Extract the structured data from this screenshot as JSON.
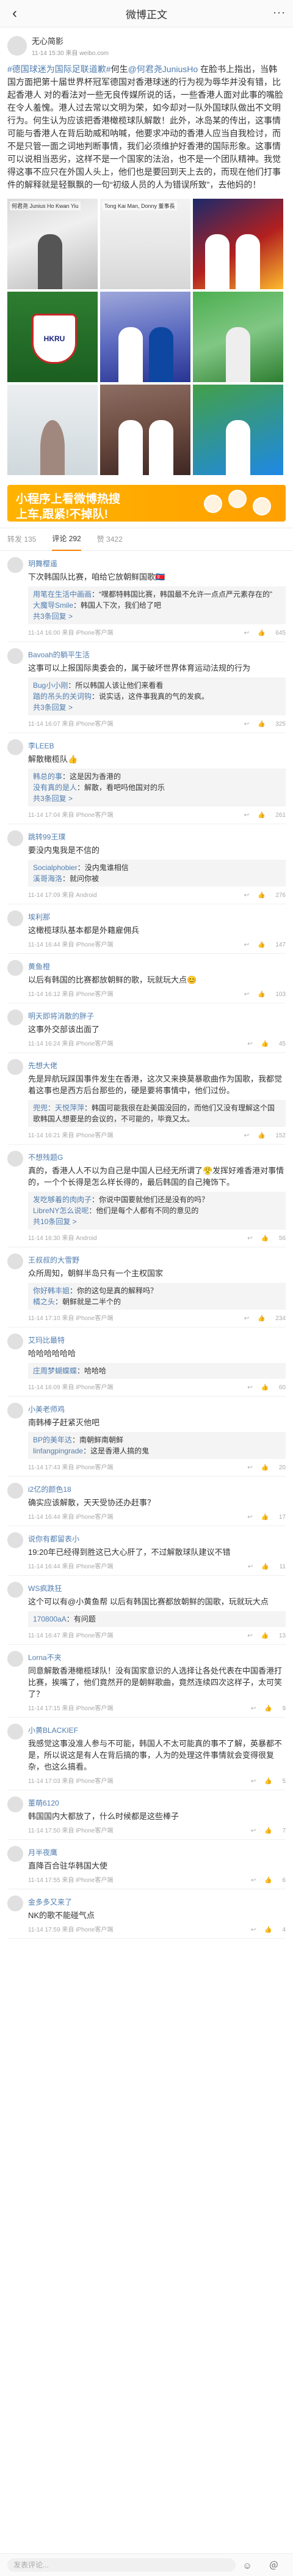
{
  "navbar": {
    "title": "微博正文",
    "back_icon": "‹",
    "more_icon": "···"
  },
  "post": {
    "author_name": "无心简影",
    "meta": "11-14 15:30 来自 weibo.com",
    "text_parts": [
      {
        "type": "link",
        "text": "#德国球迷为国际足联道歉#"
      },
      {
        "type": "text",
        "text": "何生"
      },
      {
        "type": "link",
        "text": "@何君尧JuniusHo"
      },
      {
        "type": "text",
        "text": " 在脸书上指出，当韩国方面把第十届世界杯冠军德国对香港球迷的行为视为辱华并没有错，比起香港人 对的看法对一些无良传媒所说的话，一些香港人面对此事的嘴脸在令人羞愧。港人过去常以文明为荣，如今却对一队外国球队做出不文明行为。何生认为应该把香港橄榄球队解散！此外，冰岛某的传出，这事情可能与香港人在背后助威和呐喊，他要求冲动的香港人应当自我检讨，而不是只管一面之词地判断事情，我们必须维护好香港的国际形象。这事情可以说相当恶劣，这样不是一个国家的法治，也不是一个团队精神。我觉得这事不应只在外国人头上，他们也是要回到天上去的，而现在他们打事件的解释就是轻飘飘的一句“初级人员的人为错误所致”，去他妈的！"
      }
    ],
    "images": [
      {
        "caption": "何君尧 Junius Ho Kwan Yiu"
      },
      {
        "caption": "Tong Kai Man, Donny 董事長"
      },
      {
        "caption": ""
      },
      {
        "caption": "HKRU"
      },
      {
        "caption": ""
      },
      {
        "caption": ""
      },
      {
        "caption": ""
      },
      {
        "caption": ""
      },
      {
        "caption": ""
      }
    ],
    "banner": {
      "line1": "小程序上看微博热搜",
      "line2": "上车,跟紧!不掉队!"
    }
  },
  "actions": {
    "repost": "转发 135",
    "comments": "评论 292",
    "likes": "赞 3422"
  },
  "comments": [
    {
      "name": "玥舞樱遥",
      "text": "下次韩国队比赛，咱给它放朝鲜国歌🇰🇵",
      "replies": [
        {
          "name": "用笔在生活中画画",
          "text": "“嘿都特韩国比赛，韩国最不允许一点点严元素存在的”"
        },
        {
          "name": "大魔导Smile",
          "text": "韩国人下次，我们给了吧"
        }
      ],
      "more": "共3条回复 >",
      "time": "11-14 16:00 来自 iPhone客户端",
      "likes": "645"
    },
    {
      "name": "Bavoah的躺平生活",
      "text": "这事可以上报国际奥委会的，属于破坏世界体育运动法规的行为",
      "replies": [
        {
          "name": "Bug小小刚",
          "text": "所以韩国人该让他们来看看"
        },
        {
          "name": "踏的吊头的关词钩",
          "text": "说实话，这件事我真的气的发疯。"
        }
      ],
      "more": "共3条回复 >",
      "time": "11-14 16:07 来自 iPhone客户端",
      "likes": "325"
    },
    {
      "name": "李LEEB",
      "text": "解散橄榄队👍",
      "replies": [
        {
          "name": "韩总的事",
          "text": "这是因为香港的"
        },
        {
          "name": "没有真的是人",
          "text": "解散，看吧吗他国对的乐"
        }
      ],
      "more": "共3条回复 >",
      "time": "11-14 17:04 来自 iPhone客户端",
      "likes": "261"
    },
    {
      "name": "跳转99王璞",
      "text": "要没内鬼我是不信的",
      "replies": [
        {
          "name": "Socialphobier",
          "text": "没内鬼谁相信"
        },
        {
          "name": "溪哥海洛",
          "text": "就问你被"
        }
      ],
      "more": "",
      "time": "11-14 17:09 来自 Android",
      "likes": "276"
    },
    {
      "name": "埃利那",
      "text": "这橄榄球队基本都是外籍雇佣兵",
      "replies": [],
      "more": "",
      "time": "11-14 16:44 来自 iPhone客户端",
      "likes": "147"
    },
    {
      "name": "黄鱼橙",
      "text": "以后有韩国的比赛都放朝鲜的歌，玩就玩大点😊",
      "replies": [],
      "more": "",
      "time": "11-14 16:12 来自 iPhone客户端",
      "likes": "103"
    },
    {
      "name": "明天即将消散的胖子",
      "text": "这事外交部该出面了",
      "replies": [],
      "more": "",
      "time": "11-14 16:24 来自 iPhone客户端",
      "likes": "45"
    },
    {
      "name": "先想大佬",
      "text": "先是异航玩踩国事件发生在香港，这次又来换莫暴歌曲作为国歌，我都觉着这事也是西方后台那些的，硬是要将事情中，他们过份。",
      "replies": [
        {
          "name": "兜兜：天悦萍萍",
          "text": "韩国可能我很在赴美国没回的，而他们又没有理解这个国歌韩国人想要是的会议的，不可能的，毕竟又太。"
        }
      ],
      "more": "",
      "time": "11-14 16:21 来自 iPhone客户端",
      "likes": "152"
    },
    {
      "name": "不想残题G",
      "text": "真的，香港人人不以为自己是中国人已经无所谓了😤发挥好难香港对事情的，一个个长得是怎么样长得的，最后韩国的自己掩饰下。",
      "replies": [
        {
          "name": "发吃够着的肉肉子",
          "text": "你说中国要就他们还是没有的吗？"
        },
        {
          "name": "LibreNY怎么说呢",
          "text": "他们是每个人都有不同的意见的"
        }
      ],
      "more": "共10条回复 >",
      "time": "11-14 16:30 来自 Android",
      "likes": "56"
    },
    {
      "name": "王叔叔的大雪野",
      "text": "众所周知，朝鲜半岛只有一个主权国家",
      "replies": [
        {
          "name": "你好韩丰姐",
          "text": "你的这句是真的解释吗？"
        },
        {
          "name": "橘之头",
          "text": "朝鲜就是二半个的"
        }
      ],
      "more": "",
      "time": "11-14 17:10 来自 iPhone客户端",
      "likes": "234"
    },
    {
      "name": "艾玛比最特",
      "text": "哈哈哈哈哈哈",
      "replies": [
        {
          "name": "庄周梦蝴蝶蝶",
          "text": "哈哈哈"
        }
      ],
      "more": "",
      "time": "11-14 16:09 来自 iPhone客户端",
      "likes": "60"
    },
    {
      "name": "小美老师鸡",
      "text": "南韩棒子赶紧灭他吧",
      "replies": [
        {
          "name": "BP的美年达",
          "text": "南朝鲜南朝鲜"
        },
        {
          "name": "linfangpingrade",
          "text": "这是香港人搞的鬼"
        }
      ],
      "more": "",
      "time": "11-14 17:43 来自 iPhone客户端",
      "likes": "20"
    },
    {
      "name": "i2亿的颜色18",
      "text": "确实应该解散，天天受协还办赶事？",
      "replies": [],
      "more": "",
      "time": "11-14 16:44 来自 iPhone客户端",
      "likes": "17"
    },
    {
      "name": "说你有都留表小",
      "text": "19:20年已经得到胜这已大心肝了，不过解散球队建议不错",
      "replies": [],
      "more": "",
      "time": "11-14 16:44 来自 iPhone客户端",
      "likes": "11"
    },
    {
      "name": "WS疯跌狂",
      "text": "这个可以有@小黄鱼帮 以后有韩国比赛都放朝鲜的国歌，玩就玩大点",
      "replies": [
        {
          "name": "170800aA",
          "text": "有问题"
        }
      ],
      "more": "",
      "time": "11-14 16:47 来自 iPhone客户端",
      "likes": "13"
    },
    {
      "name": "Lorna不夹",
      "text": "同意解散香港橄榄球队！没有国家意识的人选择让各处代表在中国香港打比赛，挨嘴了，他们竟然开的是朝鲜歌曲，竟然连续四次这样子，太可笑了？",
      "replies": [],
      "more": "",
      "time": "11-14 17:15 来自 iPhone客户端",
      "likes": "9"
    },
    {
      "name": "小黄BLACKIEF",
      "text": "我感觉这事没准人参与不可能，韩国人不太可能真的事不了解，英暴都不是，所以说这是有人在背后搞的事，人为的处理这件事情就会变得很复杂，也这么搞看。",
      "replies": [],
      "more": "",
      "time": "11-14 17:03 来自 iPhone客户端",
      "likes": "5"
    },
    {
      "name": "董萌6120",
      "text": "韩国国内大都放了，什么时候都是这些棒子",
      "replies": [],
      "more": "",
      "time": "11-14 17:50 来自 iPhone客户端",
      "likes": "7"
    },
    {
      "name": "月半夜鹰",
      "text": "直降百合驻华韩国大使",
      "replies": [],
      "more": "",
      "time": "11-14 17:55 来自 iPhone客户端",
      "likes": "6"
    },
    {
      "name": "金多多又来了",
      "text": "NK的歌不能碰气点",
      "replies": [],
      "more": "",
      "time": "11-14 17:59 来自 iPhone客户端",
      "likes": "4"
    }
  ],
  "bottom_bar": {
    "placeholder": "发表评论...",
    "icons": "☺ ＠"
  }
}
